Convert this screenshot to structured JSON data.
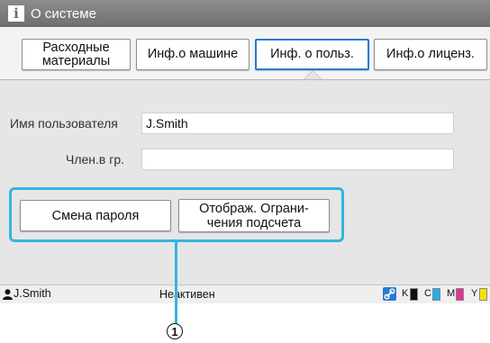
{
  "window": {
    "title": "О системе"
  },
  "tabs": [
    {
      "label": "Расходные\nматериалы",
      "active": false
    },
    {
      "label": "Инф.о машине",
      "active": false
    },
    {
      "label": "Инф. о польз.",
      "active": true
    },
    {
      "label": "Инф.о лиценз.",
      "active": false
    }
  ],
  "form": {
    "username_label": "Имя пользователя",
    "username_value": "J.Smith",
    "group_label": "Член.в гр.",
    "group_value": ""
  },
  "actions": {
    "change_password": "Смена пароля",
    "display_limits": "Отображ. Ограни-\nчения подсчета"
  },
  "status": {
    "user": "J.Smith",
    "state": "Неактивен",
    "inks": [
      {
        "label": "K",
        "color": "#111111"
      },
      {
        "label": "C",
        "color": "#29aee8"
      },
      {
        "label": "M",
        "color": "#e0348f"
      },
      {
        "label": "Y",
        "color": "#f3e500"
      }
    ]
  },
  "callout": {
    "number": "1"
  },
  "colors": {
    "accent": "#2a7bd1",
    "highlight": "#35b4e3",
    "titlebar": "#7d7d7d"
  }
}
